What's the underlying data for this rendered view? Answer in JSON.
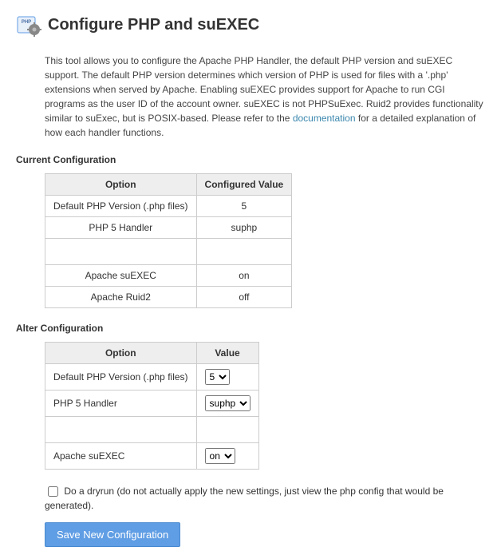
{
  "header": {
    "title": "Configure PHP and suEXEC"
  },
  "description": {
    "text_before": "This tool allows you to configure the Apache PHP Handler, the default PHP version and suEXEC support. The default PHP version determines which version of PHP is used for files with a '.php' extensions when served by Apache. Enabling suEXEC provides support for Apache to run CGI programs as the user ID of the account owner. suEXEC is not PHPSuExec. Ruid2 provides functionality similar to suExec, but is POSIX-based. Please refer to the ",
    "link_text": "documentation",
    "text_after": " for a detailed explanation of how each handler functions."
  },
  "current": {
    "title": "Current Configuration",
    "headers": [
      "Option",
      "Configured Value"
    ],
    "rows": [
      {
        "option": "Default PHP Version (.php files)",
        "value": "5"
      },
      {
        "option": "PHP 5 Handler",
        "value": "suphp"
      },
      {
        "option": "Apache suEXEC",
        "value": "on"
      },
      {
        "option": "Apache Ruid2",
        "value": "off"
      }
    ]
  },
  "alter": {
    "title": "Alter Configuration",
    "headers": [
      "Option",
      "Value"
    ],
    "rows": [
      {
        "option": "Default PHP Version (.php files)",
        "selected": "5"
      },
      {
        "option": "PHP 5 Handler",
        "selected": "suphp"
      },
      {
        "option": "Apache suEXEC",
        "selected": "on"
      }
    ]
  },
  "dryrun": {
    "label": "Do a dryrun (do not actually apply the new settings, just view the php config that would be generated)."
  },
  "save": {
    "label": "Save New Configuration"
  }
}
